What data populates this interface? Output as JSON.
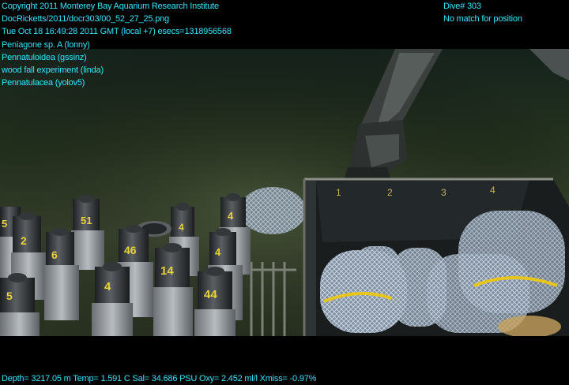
{
  "overlay": {
    "top_left_lines": [
      "Copyright 2011 Monterey Bay Aquarium Research Institute",
      "DocRicketts/2011/docr303/00_52_27_25.png",
      "Tue Oct 18 16:49:28 2011 GMT (local +7)  esecs=1318956568",
      "Peniagone sp. A (lonny)",
      "Pennatuloidea (gssinz)",
      "wood fall experiment (linda)",
      "Pennatulacea (yolov5)"
    ],
    "top_right_lines": [
      "Dive# 303",
      "No match for position"
    ],
    "bottom_line": "Depth= 3217.05 m  Temp= 1.591 C  Sal= 34.686 PSU  Oxy= 2.452 ml/l  Xmiss= -0.97%"
  },
  "scene": {
    "description_visible": false,
    "canister_labels": [
      "5",
      "2",
      "5",
      "51",
      "6",
      "46",
      "4",
      "4",
      "4",
      "14",
      "44",
      "4"
    ],
    "crate_marks": [
      "1",
      "2",
      "3",
      "4"
    ]
  },
  "colors": {
    "overlay_text": "#33e6ff",
    "seafloor": "#2f3d2a",
    "water": "#1a2a22"
  }
}
